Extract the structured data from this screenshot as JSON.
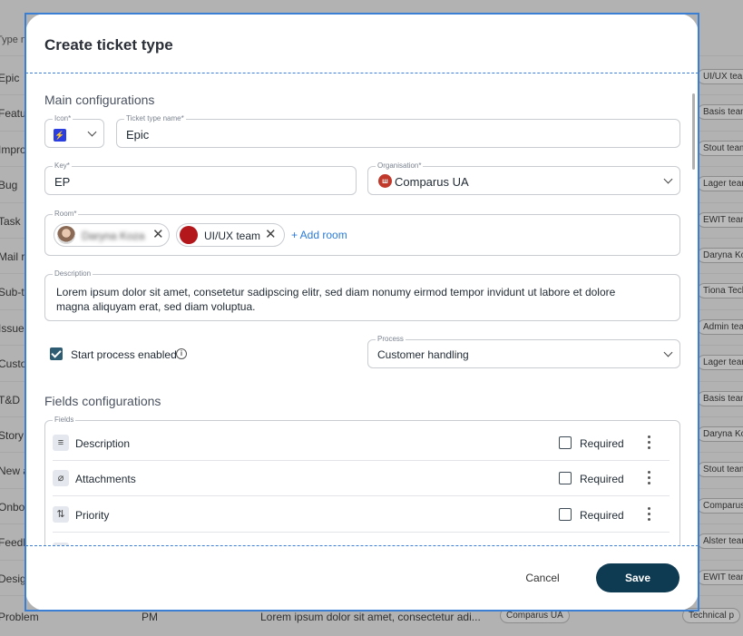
{
  "background": {
    "header_left": "Type na",
    "rows": [
      {
        "name": "Epic",
        "team": "UI/UX team"
      },
      {
        "name": "Featu",
        "team": "Basis team"
      },
      {
        "name": "Impro",
        "team": "Stout team"
      },
      {
        "name": "Bug",
        "team": "Lager team"
      },
      {
        "name": "Task",
        "team": "EWIT team"
      },
      {
        "name": "Mail r",
        "team": "Daryna Koza"
      },
      {
        "name": "Sub-ta",
        "team": "Tiona Techn"
      },
      {
        "name": "Issue",
        "team": "Admin team"
      },
      {
        "name": "Custo",
        "team": "Lager team"
      },
      {
        "name": "T&D",
        "team": "Basis team"
      },
      {
        "name": "Story",
        "team": "Daryna Koza"
      },
      {
        "name": "New a",
        "team": "Stout team"
      },
      {
        "name": "Onboa",
        "team": "Comparus U"
      },
      {
        "name": "Feedb",
        "team": "Alster team"
      },
      {
        "name": "Desig",
        "team": "EWIT team"
      }
    ],
    "last_row": {
      "name": "Problem",
      "key": "PM",
      "description": "Lorem ipsum dolor sit amet, consectetur adi...",
      "org": "Comparus UA",
      "team": "Technical p"
    }
  },
  "modal": {
    "title": "Create ticket type",
    "main_section": "Main configurations",
    "icon": {
      "label": "Icon*",
      "glyph": "⚡",
      "color": "#2b3fe0"
    },
    "ticket_type_name": {
      "label": "Ticket type name*",
      "value": "Epic"
    },
    "key": {
      "label": "Key*",
      "value": "EP"
    },
    "organisation": {
      "label": "Organisation*",
      "value": "Comparus UA"
    },
    "room": {
      "label": "Room*",
      "chips": [
        {
          "label": "Daryna Koza",
          "blurred": true
        },
        {
          "label": "UI/UX team",
          "blurred": false
        }
      ],
      "add_label": "+ Add room"
    },
    "description": {
      "label": "Description",
      "value": "Lorem ipsum dolor sit amet, consetetur sadipscing elitr, sed diam nonumy eirmod tempor invidunt ut labore et dolore magna aliquyam erat, sed diam voluptua."
    },
    "start_process": {
      "label": "Start process enabled",
      "checked": true
    },
    "process": {
      "label": "Process",
      "value": "Customer handling"
    },
    "fields_section": "Fields configurations",
    "fields_label": "Fields",
    "fields": [
      {
        "name": "Description",
        "icon": "text-lines-icon",
        "glyph": "≡",
        "required_label": "Required",
        "required": false
      },
      {
        "name": "Attachments",
        "icon": "paperclip-icon",
        "glyph": "⌀",
        "required_label": "Required",
        "required": false
      },
      {
        "name": "Priority",
        "icon": "sort-arrows-icon",
        "glyph": "⇅",
        "required_label": "Required",
        "required": false
      }
    ],
    "cancel_label": "Cancel",
    "save_label": "Save"
  }
}
